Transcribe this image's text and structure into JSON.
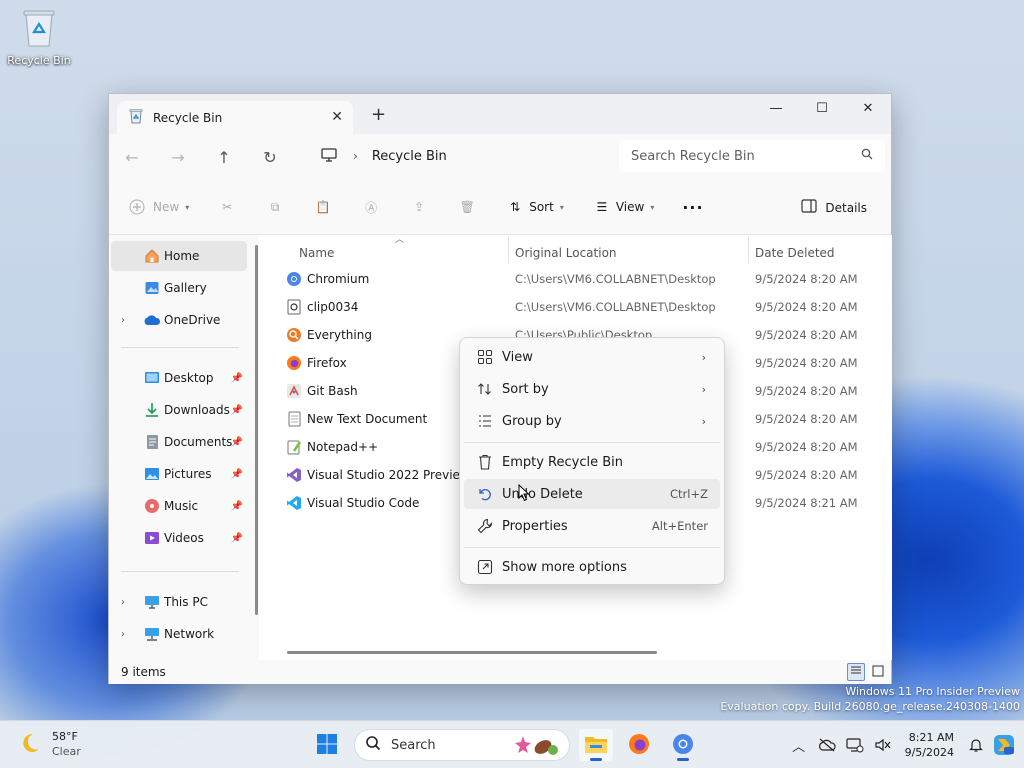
{
  "desktop": {
    "recycle_bin_label": "Recycle Bin",
    "watermark_line1": "Windows 11 Pro Insider Preview",
    "watermark_line2": "Evaluation copy. Build 26080.ge_release.240308-1400"
  },
  "window": {
    "tab_title": "Recycle Bin",
    "tab_close": "✕",
    "new_tab": "+",
    "address_path": "Recycle Bin",
    "search_placeholder": "Search Recycle Bin"
  },
  "toolbar": {
    "new_label": "New",
    "sort_label": "Sort",
    "view_label": "View",
    "more_label": "···",
    "details_label": "Details"
  },
  "sidebar": {
    "items": [
      {
        "label": "Home"
      },
      {
        "label": "Gallery"
      },
      {
        "label": "OneDrive"
      },
      {
        "label": "Desktop"
      },
      {
        "label": "Downloads"
      },
      {
        "label": "Documents"
      },
      {
        "label": "Pictures"
      },
      {
        "label": "Music"
      },
      {
        "label": "Videos"
      },
      {
        "label": "This PC"
      },
      {
        "label": "Network"
      }
    ]
  },
  "columns": {
    "name": "Name",
    "location": "Original Location",
    "date": "Date Deleted"
  },
  "files": [
    {
      "name": "Chromium",
      "location": "C:\\Users\\VM6.COLLABNET\\Desktop",
      "date": "9/5/2024 8:20 AM"
    },
    {
      "name": "clip0034",
      "location": "C:\\Users\\VM6.COLLABNET\\Desktop",
      "date": "9/5/2024 8:20 AM"
    },
    {
      "name": "Everything",
      "location": "C:\\Users\\Public\\Desktop",
      "date": "9/5/2024 8:20 AM"
    },
    {
      "name": "Firefox",
      "location": "",
      "date": "9/5/2024 8:20 AM"
    },
    {
      "name": "Git Bash",
      "location": "",
      "date": "9/5/2024 8:20 AM"
    },
    {
      "name": "New Text Document",
      "location": "",
      "date": "9/5/2024 8:20 AM"
    },
    {
      "name": "Notepad++",
      "location": "",
      "date": "9/5/2024 8:20 AM"
    },
    {
      "name": "Visual Studio 2022 Preview",
      "location": "",
      "date": "9/5/2024 8:20 AM"
    },
    {
      "name": "Visual Studio Code",
      "location": "",
      "date": "9/5/2024 8:21 AM"
    }
  ],
  "status": {
    "item_count": "9 items"
  },
  "context_menu": {
    "view": "View",
    "sort_by": "Sort by",
    "group_by": "Group by",
    "empty_recycle_bin": "Empty Recycle Bin",
    "undo_delete": "Undo Delete",
    "undo_shortcut": "Ctrl+Z",
    "properties": "Properties",
    "properties_shortcut": "Alt+Enter",
    "show_more_options": "Show more options"
  },
  "taskbar": {
    "temperature": "58°F",
    "condition": "Clear",
    "search_label": "Search",
    "time": "8:21 AM",
    "date": "9/5/2024"
  },
  "colors": {
    "accent": "#2a62c9",
    "folder_yellow": "#f2b824",
    "onedrive_blue": "#1f6fd1"
  }
}
